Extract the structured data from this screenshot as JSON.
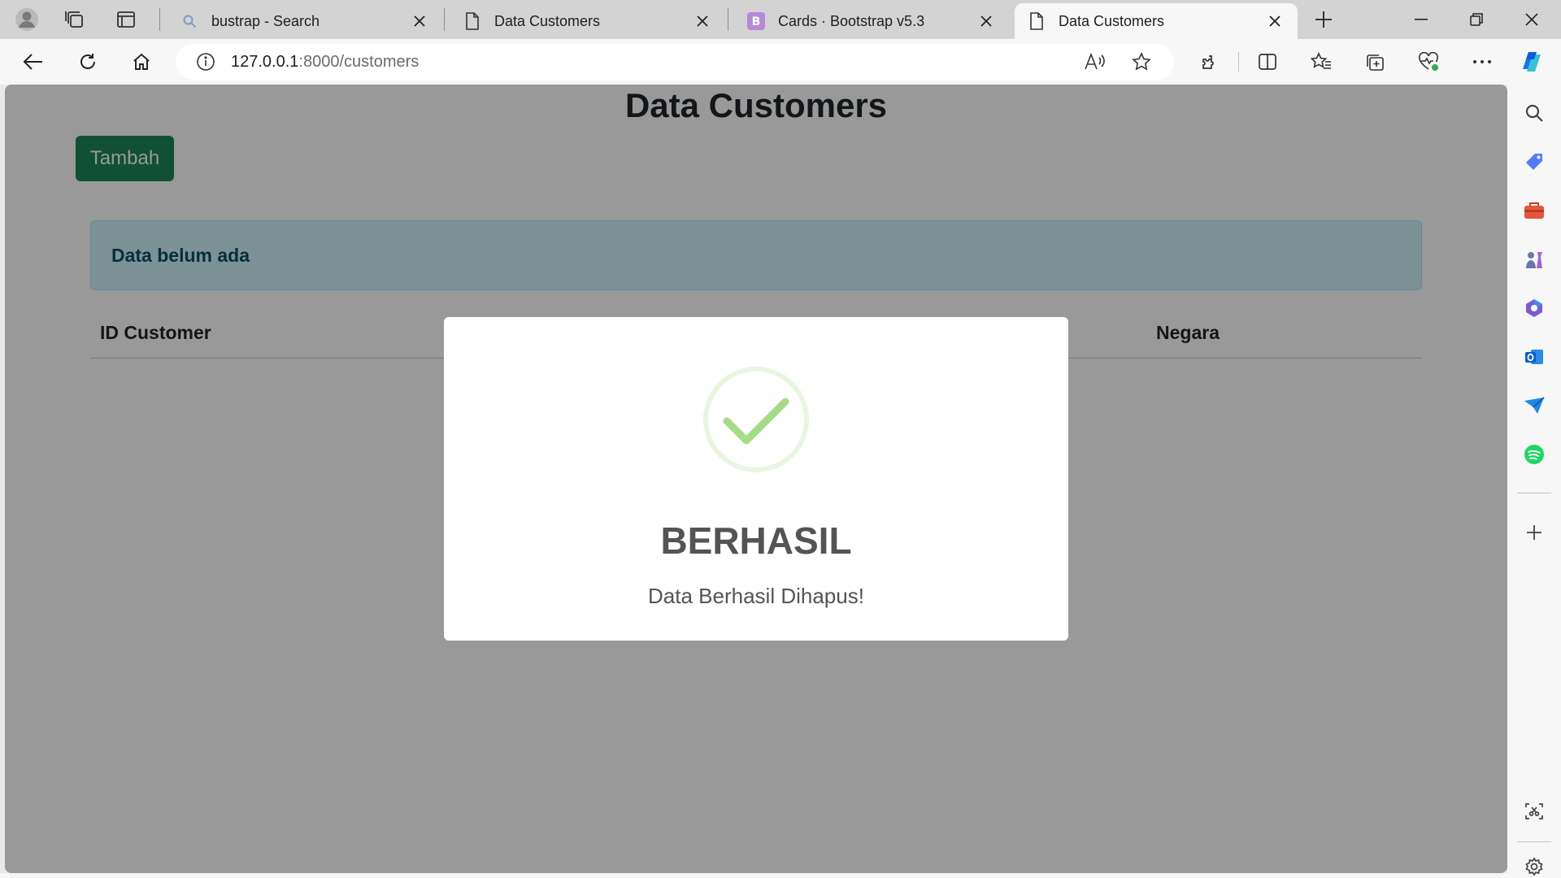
{
  "browser": {
    "tabs": [
      {
        "title": "bustrap - Search",
        "favicon": "search-icon",
        "active": false
      },
      {
        "title": "Data Customers",
        "favicon": "page-icon",
        "active": false
      },
      {
        "title": "Cards · Bootstrap v5.3",
        "favicon": "bootstrap-icon",
        "active": false
      },
      {
        "title": "Data Customers",
        "favicon": "page-icon",
        "active": true
      }
    ],
    "address": {
      "host": "127.0.0.1",
      "path": ":8000/customers"
    },
    "bootstrap_letter": "B"
  },
  "page": {
    "title": "Data Customers",
    "add_button": "Tambah",
    "alert": "Data belum ada",
    "columns": [
      "ID Customer",
      "Negara"
    ]
  },
  "modal": {
    "title": "BERHASIL",
    "message": "Data Berhasil Dihapus!"
  },
  "colors": {
    "success": "#198754",
    "alert_bg": "#cff4fc",
    "alert_text": "#055160",
    "check": "#a5dc86"
  }
}
